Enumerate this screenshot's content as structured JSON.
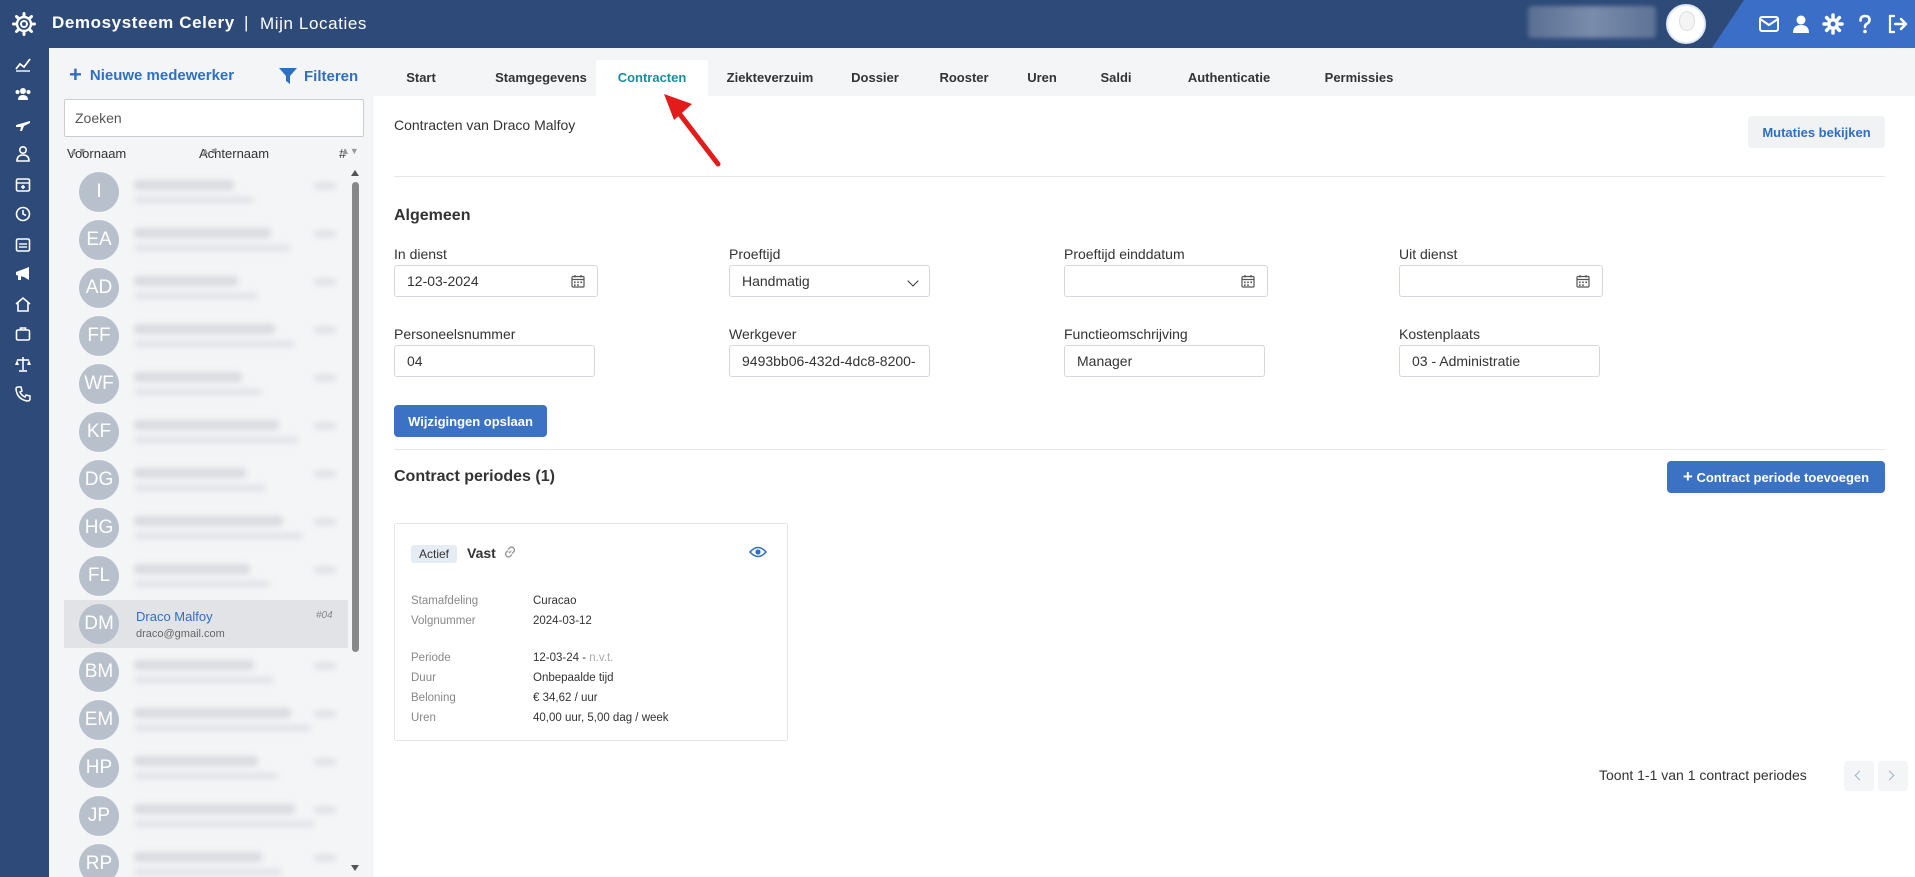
{
  "header": {
    "app_title": "Demosysteem Celery",
    "separator": "|",
    "location_title": "Mijn Locaties",
    "icons": [
      "settings-gear-logo-icon",
      "mail-icon",
      "user-icon",
      "gear-icon",
      "help-icon",
      "logout-icon"
    ]
  },
  "left_nav": {
    "icons": [
      "chart-icon",
      "users-icon",
      "plane-icon",
      "person-icon",
      "calendar-icon",
      "clock-icon",
      "calendar-list-icon",
      "megaphone-icon",
      "home-icon",
      "briefcase-icon",
      "scale-icon",
      "phone-icon"
    ]
  },
  "employees": {
    "new_label": "Nieuwe medewerker",
    "filter_label": "Filteren",
    "search_placeholder": "Zoeken",
    "columns": {
      "first_name": "Voornaam",
      "last_name": "Achternaam",
      "number": "#"
    },
    "rows": [
      {
        "initials": "I"
      },
      {
        "initials": "EA"
      },
      {
        "initials": "AD"
      },
      {
        "initials": "FF"
      },
      {
        "initials": "WF"
      },
      {
        "initials": "KF"
      },
      {
        "initials": "DG"
      },
      {
        "initials": "HG"
      },
      {
        "initials": "FL"
      },
      {
        "initials": "DM",
        "name": "Draco Malfoy",
        "email": "draco@gmail.com",
        "number": "#04",
        "selected": true
      },
      {
        "initials": "BM"
      },
      {
        "initials": "EM"
      },
      {
        "initials": "HP"
      },
      {
        "initials": "JP"
      },
      {
        "initials": "RP"
      }
    ]
  },
  "tabs": [
    {
      "label": "Start"
    },
    {
      "label": "Stamgegevens"
    },
    {
      "label": "Contracten",
      "active": true
    },
    {
      "label": "Ziekteverzuim"
    },
    {
      "label": "Dossier"
    },
    {
      "label": "Rooster"
    },
    {
      "label": "Uren"
    },
    {
      "label": "Saldi"
    },
    {
      "label": "Authenticatie"
    },
    {
      "label": "Permissies"
    }
  ],
  "main": {
    "title": "Contracten van Draco Malfoy",
    "mutations_button": "Mutaties bekijken",
    "general": {
      "title": "Algemeen",
      "in_service_label": "In dienst",
      "in_service_value": "12-03-2024",
      "probation_label": "Proeftijd",
      "probation_value": "Handmatig",
      "probation_end_label": "Proeftijd einddatum",
      "probation_end_value": "",
      "out_service_label": "Uit dienst",
      "out_service_value": "",
      "personnel_number_label": "Personeelsnummer",
      "personnel_number_value": "04",
      "employer_label": "Werkgever",
      "employer_value": "9493bb06-432d-4dc8-8200-",
      "function_label": "Functieomschrijving",
      "function_value": "Manager",
      "cost_center_label": "Kostenplaats",
      "cost_center_value": "03 - Administratie",
      "save_button": "Wijzigingen opslaan"
    },
    "periods": {
      "title": "Contract periodes (1)",
      "add_button": "Contract periode toevoegen",
      "card": {
        "badge": "Actief",
        "title": "Vast",
        "rows": [
          {
            "key": "Stamafdeling",
            "value": "Curacao"
          },
          {
            "key": "Volgnummer",
            "value": "2024-03-12"
          },
          {
            "key": "Periode",
            "value": "12-03-24 -",
            "muted": "n.v.t."
          },
          {
            "key": "Duur",
            "value": "Onbepaalde tijd"
          },
          {
            "key": "Beloning",
            "value": "€ 34,62 / uur"
          },
          {
            "key": "Uren",
            "value": "40,00 uur, 5,00 dag / week"
          }
        ]
      },
      "pager_text": "Toont 1-1 van 1 contract periodes"
    }
  },
  "colors": {
    "header_bg": "#2e4a78",
    "accent_blue": "#3b72c4",
    "active_tab": "#1a8e9e",
    "annotation_arrow": "#e21b1b"
  }
}
